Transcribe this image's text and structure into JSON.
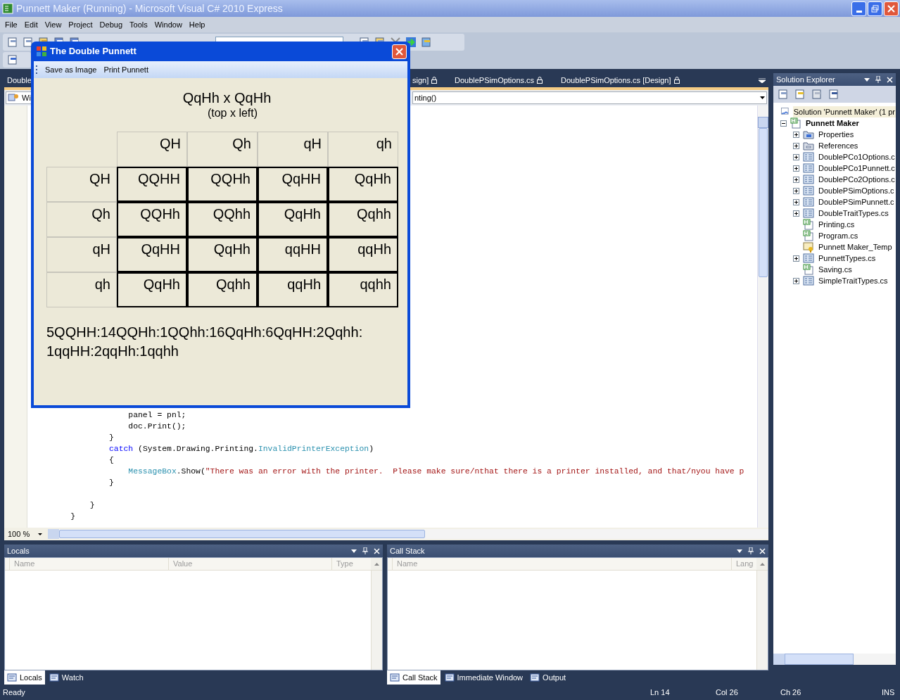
{
  "window": {
    "title": "Punnett Maker (Running) - Microsoft Visual C# 2010 Express"
  },
  "menu": [
    "File",
    "Edit",
    "View",
    "Project",
    "Debug",
    "Tools",
    "Window",
    "Help"
  ],
  "document_tabs": [
    {
      "label": "Double"
    },
    {
      "label": "sign]"
    },
    {
      "label": "DoublePSimOptions.cs"
    },
    {
      "label": "DoublePSimOptions.cs [Design]"
    }
  ],
  "navigation": {
    "type_combo": "Wi",
    "member_combo": "nting()"
  },
  "code_lines": [
    {
      "kind": "code",
      "tokens": [
        {
          "kind": "plain",
          "text": "                panel = pnl;"
        }
      ]
    },
    {
      "kind": "code",
      "tokens": [
        {
          "kind": "plain",
          "text": "                doc.Print();"
        }
      ]
    },
    {
      "kind": "code",
      "tokens": [
        {
          "kind": "plain",
          "text": "            }"
        }
      ]
    },
    {
      "kind": "code",
      "tokens": [
        {
          "kind": "keyword",
          "text": "            catch"
        },
        {
          "kind": "plain",
          "text": " (System.Drawing.Printing."
        },
        {
          "kind": "type",
          "text": "InvalidPrinterException"
        },
        {
          "kind": "plain",
          "text": ")"
        }
      ]
    },
    {
      "kind": "code",
      "tokens": [
        {
          "kind": "plain",
          "text": "            {"
        }
      ]
    },
    {
      "kind": "code",
      "tokens": [
        {
          "kind": "type",
          "text": "                MessageBox"
        },
        {
          "kind": "plain",
          "text": ".Show("
        },
        {
          "kind": "string",
          "text": "\"There was an error with the printer.  Please make sure/nthat there is a printer installed, and that/nyou have p"
        }
      ]
    },
    {
      "kind": "code",
      "tokens": [
        {
          "kind": "plain",
          "text": "            }"
        }
      ]
    },
    {
      "kind": "blank"
    },
    {
      "kind": "code",
      "tokens": [
        {
          "kind": "plain",
          "text": "        }"
        }
      ]
    },
    {
      "kind": "code",
      "tokens": [
        {
          "kind": "plain",
          "text": "    }"
        }
      ]
    }
  ],
  "zoom": "100 %",
  "dialog": {
    "title": "The Double Punnett",
    "menu": [
      "Save as Image",
      "Print Punnett"
    ],
    "heading": "QqHh x QqHh",
    "subheading": "(top x left)",
    "columns": [
      "QH",
      "Qh",
      "qH",
      "qh"
    ],
    "rows": [
      {
        "label": "QH",
        "cells": [
          "QQHH",
          "QQHh",
          "QqHH",
          "QqHh"
        ]
      },
      {
        "label": "Qh",
        "cells": [
          "QQHh",
          "QQhh",
          "QqHh",
          "Qqhh"
        ]
      },
      {
        "label": "qH",
        "cells": [
          "QqHH",
          "QqHh",
          "qqHH",
          "qqHh"
        ]
      },
      {
        "label": "qh",
        "cells": [
          "QqHh",
          "Qqhh",
          "qqHh",
          "qqhh"
        ]
      }
    ],
    "summary": "5QQHH:14QQHh:1QQhh:16QqHh:6QqHH:2Qqhh:1qqHH:2qqHh:1qqhh"
  },
  "solution_explorer": {
    "title": "Solution Explorer",
    "tree": [
      {
        "label": "Solution 'Punnett Maker' (1 pr",
        "kind": "solution",
        "toggle": false,
        "selected": true,
        "children": [
          {
            "label": "Punnett Maker",
            "kind": "project",
            "toggle": true,
            "expanded": true,
            "selected": false,
            "children": [
              {
                "label": "Properties",
                "kind": "properties",
                "toggle": true,
                "expanded": false,
                "selected": false
              },
              {
                "label": "References",
                "kind": "references",
                "toggle": true,
                "expanded": false,
                "selected": false
              },
              {
                "label": "DoublePCo1Options.c",
                "kind": "form",
                "toggle": true,
                "expanded": false,
                "selected": false
              },
              {
                "label": "DoublePCo1Punnett.c",
                "kind": "form",
                "toggle": true,
                "expanded": false,
                "selected": false
              },
              {
                "label": "DoublePCo2Options.c",
                "kind": "form",
                "toggle": true,
                "expanded": false,
                "selected": false
              },
              {
                "label": "DoublePSimOptions.c",
                "kind": "form",
                "toggle": true,
                "expanded": false,
                "selected": false
              },
              {
                "label": "DoublePSimPunnett.c",
                "kind": "form",
                "toggle": true,
                "expanded": false,
                "selected": false
              },
              {
                "label": "DoubleTraitTypes.cs",
                "kind": "form",
                "toggle": true,
                "expanded": false,
                "selected": false
              },
              {
                "label": "Printing.cs",
                "kind": "code",
                "toggle": false,
                "selected": false
              },
              {
                "label": "Program.cs",
                "kind": "code",
                "toggle": false,
                "selected": false
              },
              {
                "label": "Punnett Maker_Temp",
                "kind": "certificate",
                "toggle": false,
                "selected": false
              },
              {
                "label": "PunnettTypes.cs",
                "kind": "form",
                "toggle": true,
                "expanded": false,
                "selected": false
              },
              {
                "label": "Saving.cs",
                "kind": "code",
                "toggle": false,
                "selected": false
              },
              {
                "label": "SimpleTraitTypes.cs",
                "kind": "form",
                "toggle": true,
                "expanded": false,
                "selected": false
              }
            ]
          }
        ]
      }
    ]
  },
  "locals": {
    "title": "Locals",
    "columns": [
      "Name",
      "Value",
      "Type"
    ]
  },
  "call_stack": {
    "title": "Call Stack",
    "columns": [
      "Name",
      "Lang"
    ]
  },
  "bottom_left_tabs": [
    {
      "label": "Locals",
      "selected": true
    },
    {
      "label": "Watch",
      "selected": false
    }
  ],
  "bottom_right_tabs": [
    {
      "label": "Call Stack",
      "selected": true
    },
    {
      "label": "Immediate Window",
      "selected": false
    },
    {
      "label": "Output",
      "selected": false
    }
  ],
  "status_bar": [
    "Ready",
    "Ln 14",
    "Col 26",
    "Ch 26",
    "INS"
  ]
}
